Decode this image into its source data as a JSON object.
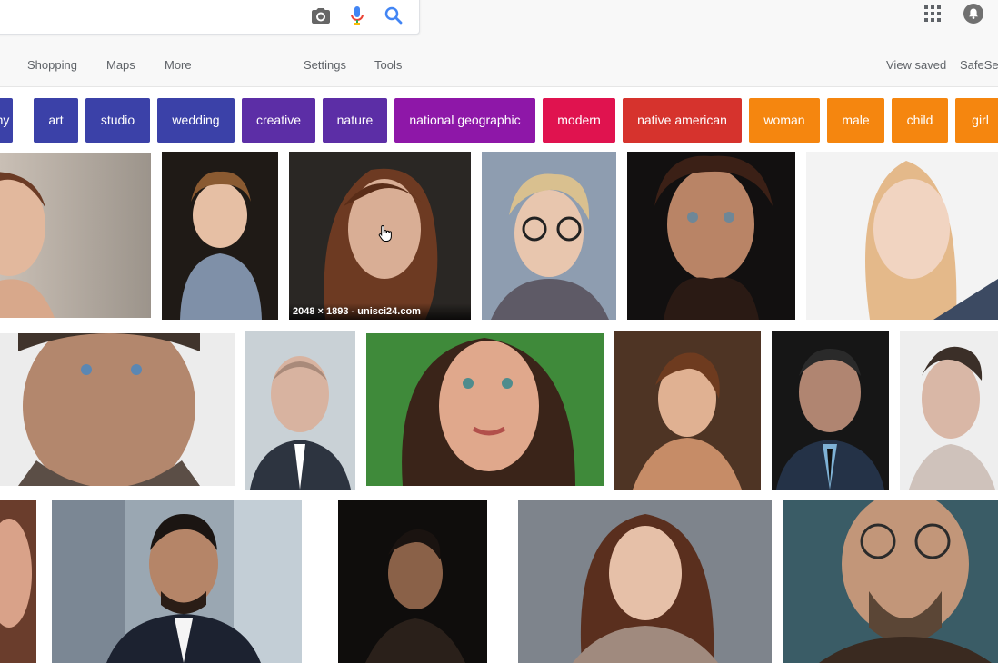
{
  "search": {
    "value": "",
    "icons": [
      "camera-icon",
      "microphone-icon",
      "search-icon"
    ]
  },
  "header": {
    "icons": [
      "apps-grid-icon",
      "account-bell-icon"
    ]
  },
  "tabs": {
    "shopping": "Shopping",
    "maps": "Maps",
    "more": "More",
    "settings": "Settings",
    "tools": "Tools",
    "view_saved": "View saved",
    "safesearch": "SafeSe"
  },
  "chips": [
    {
      "label": "hy",
      "color": "#3b41a8"
    },
    {
      "label": "art",
      "color": "#3b41a8"
    },
    {
      "label": "studio",
      "color": "#3b41a8"
    },
    {
      "label": "wedding",
      "color": "#3b41a8"
    },
    {
      "label": "creative",
      "color": "#5c2ea6"
    },
    {
      "label": "nature",
      "color": "#5c2ea6"
    },
    {
      "label": "national geographic",
      "color": "#8e17a8"
    },
    {
      "label": "modern",
      "color": "#e0134f"
    },
    {
      "label": "native american",
      "color": "#d6332d"
    },
    {
      "label": "woman",
      "color": "#f5860f"
    },
    {
      "label": "male",
      "color": "#f5860f"
    },
    {
      "label": "child",
      "color": "#f5860f"
    },
    {
      "label": "girl",
      "color": "#f5860f"
    }
  ],
  "results": {
    "hover_caption": "2048 × 1893 - unisci24.com"
  }
}
